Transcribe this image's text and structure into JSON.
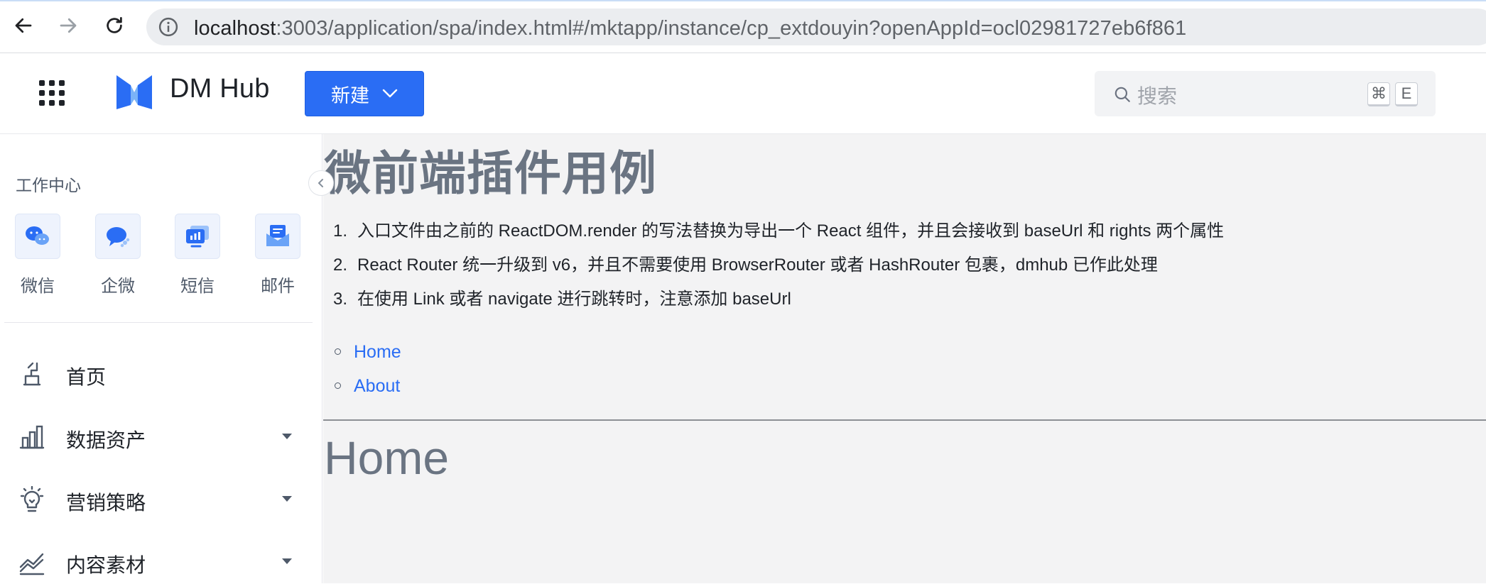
{
  "browser": {
    "url_host": "localhost",
    "url_path": ":3003/application/spa/index.html#/mktapp/instance/cp_extdouyin?openAppId=ocl02981727eb6f861"
  },
  "header": {
    "brand": "DM Hub",
    "new_button_label": "新建",
    "search_placeholder": "搜索",
    "shortcut_keys": [
      "⌘",
      "E"
    ],
    "accent_color": "#2a6df4"
  },
  "sidebar": {
    "section_title": "工作中心",
    "channels": [
      {
        "label": "微信",
        "icon": "wechat-icon"
      },
      {
        "label": "企微",
        "icon": "wecom-icon"
      },
      {
        "label": "短信",
        "icon": "sms-icon"
      },
      {
        "label": "邮件",
        "icon": "mail-icon"
      }
    ],
    "menu": [
      {
        "label": "首页",
        "icon": "home-icon",
        "expandable": false
      },
      {
        "label": "数据资产",
        "icon": "bar-chart-icon",
        "expandable": true
      },
      {
        "label": "营销策略",
        "icon": "lightbulb-icon",
        "expandable": true
      },
      {
        "label": "内容素材",
        "icon": "line-chart-icon",
        "expandable": true
      }
    ]
  },
  "main": {
    "title": "微前端插件用例",
    "steps": [
      {
        "num": "1.",
        "text": "入口文件由之前的 ReactDOM.render 的写法替换为导出一个 React 组件，并且会接收到 baseUrl 和 rights 两个属性"
      },
      {
        "num": "2.",
        "text": "React Router 统一升级到 v6，并且不需要使用 BrowserRouter 或者 HashRouter 包裹，dmhub 已作此处理"
      },
      {
        "num": "3.",
        "text": "在使用 Link 或者 navigate 进行跳转时，注意添加 baseUrl"
      }
    ],
    "links": [
      "Home",
      "About"
    ],
    "route_heading": "Home"
  }
}
